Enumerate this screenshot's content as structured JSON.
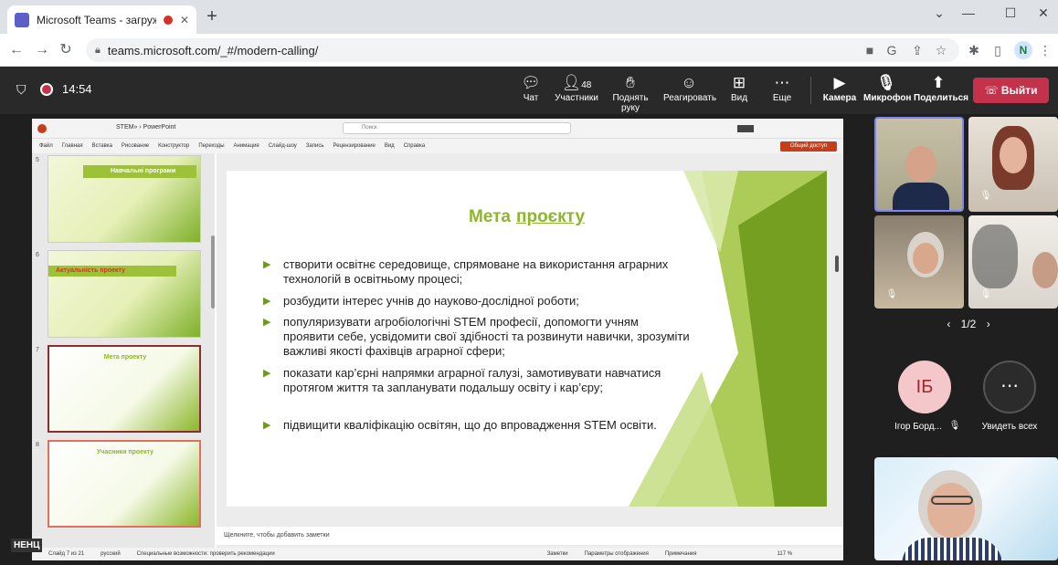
{
  "browser": {
    "tab_title": "Microsoft Teams - загружае",
    "new_tab": "+",
    "url": "teams.microsoft.com/_#/modern-calling/",
    "profile_initial": "N"
  },
  "teams": {
    "timer": "14:54",
    "chat_label": "Чат",
    "participants_count": "48",
    "participants_label": "Участники",
    "raise_hand_label": "Поднять руку",
    "react_label": "Реагировать",
    "view_label": "Вид",
    "more_label": "Еще",
    "camera_label": "Камера",
    "mic_label": "Микрофон",
    "share_label": "Поделиться",
    "leave_label": "Выйти",
    "pager": "1/2",
    "participant_initials": "ІБ",
    "participant_name": "Ігор Борд...",
    "see_all_label": "Увидеть всех"
  },
  "powerpoint": {
    "file_name": "STEM» › PowerPoint",
    "search_placeholder": "Поиск",
    "menu": [
      "Файл",
      "Главная",
      "Вставка",
      "Рисование",
      "Конструктор",
      "Переходы",
      "Анимация",
      "Слайд-шоу",
      "Запись",
      "Рецензирование",
      "Вид",
      "Справка"
    ],
    "share_button": "Общий доступ",
    "notes_placeholder": "Щелкните, чтобы добавить заметки",
    "status_left": "Слайд 7 из 21",
    "status_lang": "русский",
    "status_access": "Специальные возможности: проверить рекомендации",
    "status_notes": "Заметки",
    "status_display": "Параметры отображения",
    "status_comments": "Примечания",
    "status_zoom": "117 %",
    "thumbs": [
      {
        "num": "5",
        "title": "Навчальні програми"
      },
      {
        "num": "6",
        "title": "Актуальність проекту"
      },
      {
        "num": "7",
        "title": "Мета проекту"
      },
      {
        "num": "8",
        "title": "Учасники проекту"
      }
    ]
  },
  "slide": {
    "title_main": "Мета",
    "title_underlined": "проєкту",
    "bullets": [
      "створити освітнє середовище, спрямоване на використання аграрних технологій в освітньому процесі;",
      "розбудити інтерес учнів до науково-дослідної роботи;",
      "популяризувати агробіологічні STEM професії, допомогти учням проявити себе, усвідомити свої здібності та розвинути навички, зрозуміти важливі якості фахівців аграрної сфери;",
      "показати кар’єрні напрямки аграрної галузі, замотивувати навчатися протягом життя та запланувати подальшу освіту і кар’єру;",
      "підвищити кваліфікацію освітян, що до впровадження STEM освіти."
    ]
  },
  "overlay_label": "НЕНЦ",
  "colors": {
    "accent": "#8bb729",
    "leave": "#c4314b",
    "teams_bar": "#292929"
  }
}
